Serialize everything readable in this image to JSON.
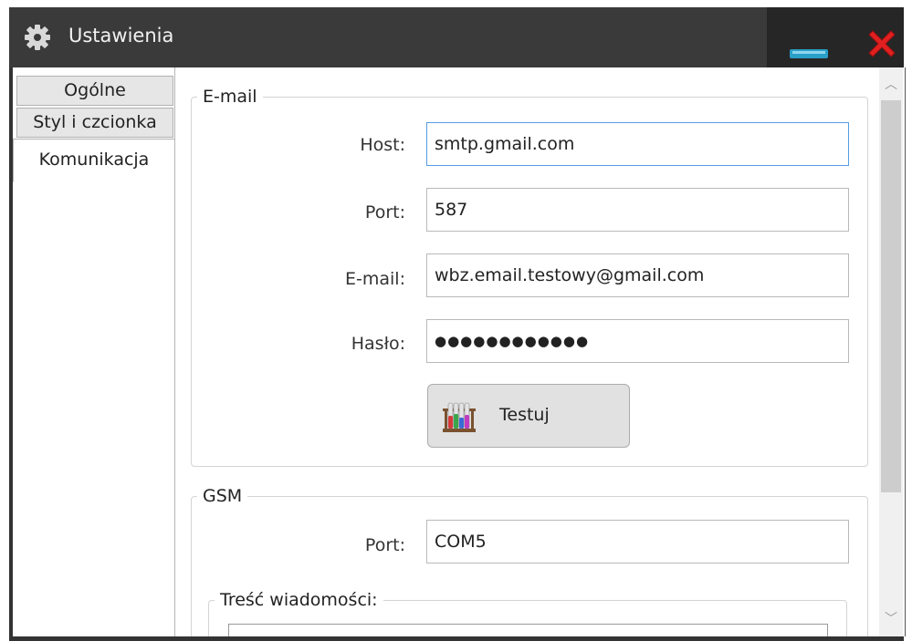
{
  "window": {
    "title": "Ustawienia"
  },
  "tabs": [
    {
      "label": "Ogólne"
    },
    {
      "label": "Styl i czcionka"
    },
    {
      "label": "Komunikacja"
    }
  ],
  "email_group": {
    "legend": "E-mail",
    "host_label": "Host:",
    "host_value": "smtp.gmail.com",
    "port_label": "Port:",
    "port_value": "587",
    "email_label": "E-mail:",
    "email_value": "wbz.email.testowy@gmail.com",
    "password_label": "Hasło:",
    "password_value": "●●●●●●●●●●●●",
    "test_button": "Testuj"
  },
  "gsm_group": {
    "legend": "GSM",
    "port_label": "Port:",
    "port_value": "COM5",
    "message_legend": "Treść wiadomości:"
  },
  "icons": {
    "settings": "gear-icon",
    "minimize": "minimize-icon",
    "close": "close-icon",
    "test": "test-tubes-icon"
  },
  "colors": {
    "titlebar": "#3a3a3a",
    "close": "#e02020",
    "focus_border": "#569de5"
  }
}
